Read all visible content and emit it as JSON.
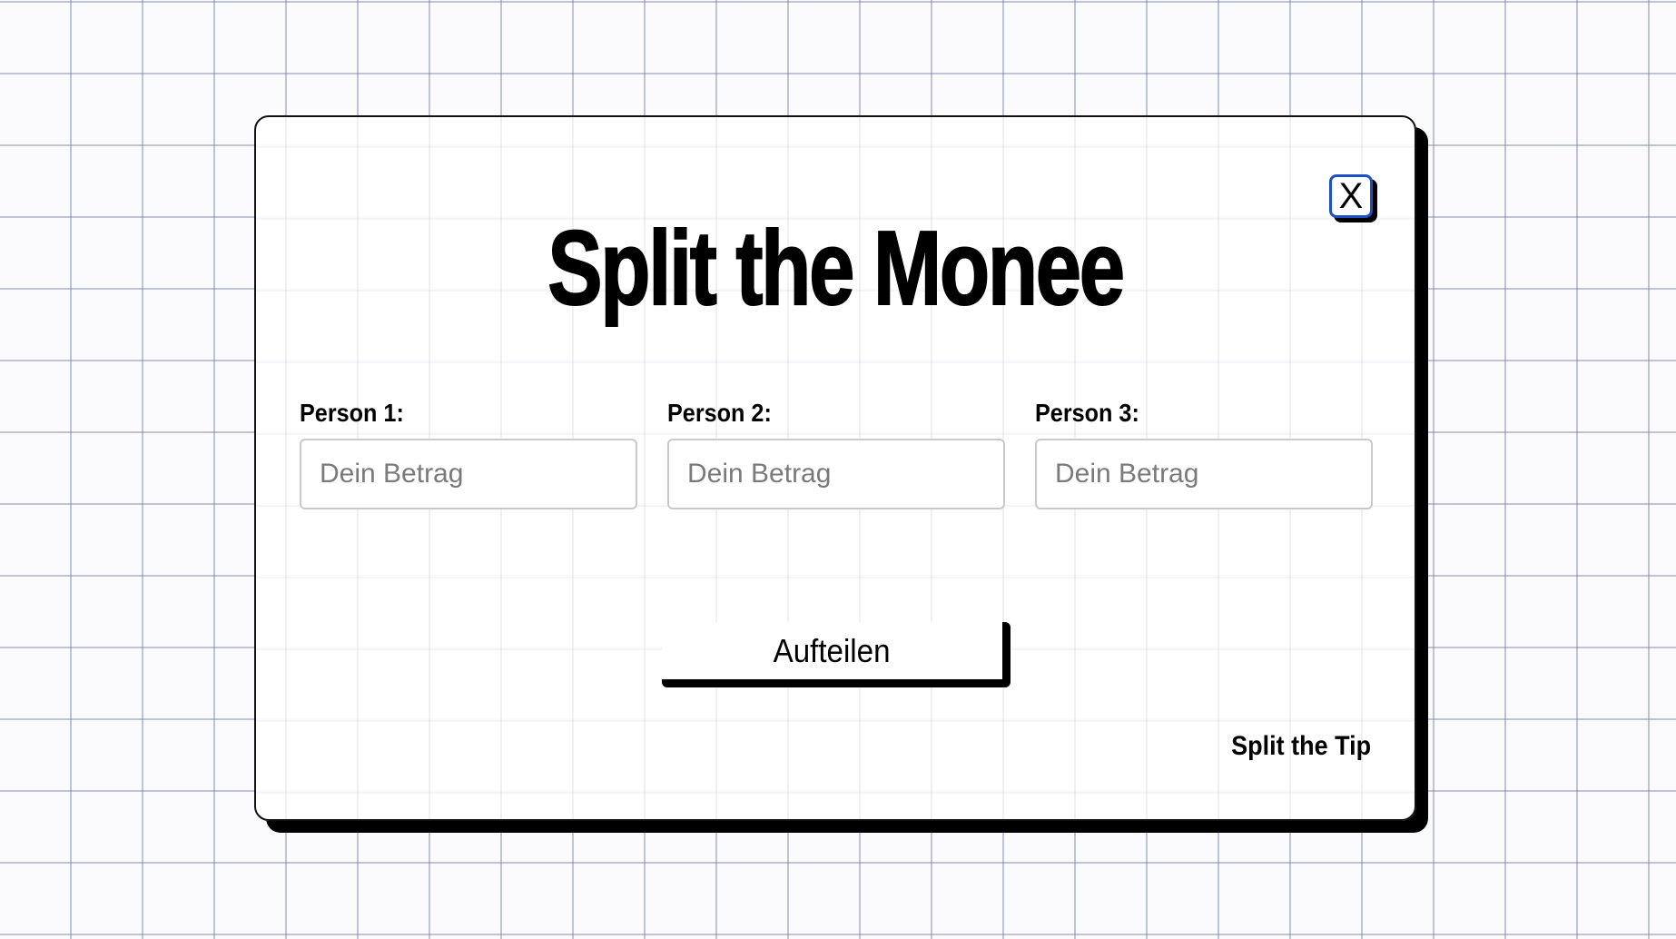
{
  "card": {
    "close_label": "X",
    "title": "Split the Monee",
    "persons": [
      {
        "label": "Person 1:",
        "placeholder": "Dein Betrag",
        "value": ""
      },
      {
        "label": "Person 2:",
        "placeholder": "Dein Betrag",
        "value": ""
      },
      {
        "label": "Person 3:",
        "placeholder": "Dein Betrag",
        "value": ""
      }
    ],
    "split_button_label": "Aufteilen",
    "tip_link_label": "Split the Tip"
  },
  "colors": {
    "background": "#fbfbfe",
    "grid_lines": "#787da5",
    "card": "#ffffff",
    "shadow": "#000000",
    "close_border": "#1f4fc4",
    "input_border": "#c9c9c9",
    "placeholder_text": "#7a7a7a"
  },
  "icons": {
    "close": "close-icon"
  }
}
